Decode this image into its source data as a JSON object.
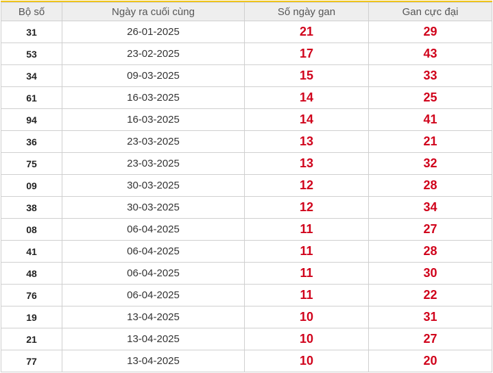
{
  "header": {
    "col_number": "Bộ số",
    "col_last_date": "Ngày ra cuối cùng",
    "col_days_gan": "Số ngày gan",
    "col_max_gan": "Gan cực đại"
  },
  "colors": {
    "accent_border": "#f0c419",
    "value_red": "#d0021b",
    "header_bg": "#eeeeee"
  },
  "rows": [
    {
      "number": "31",
      "last_date": "26-01-2025",
      "days_gan": "21",
      "max_gan": "29"
    },
    {
      "number": "53",
      "last_date": "23-02-2025",
      "days_gan": "17",
      "max_gan": "43"
    },
    {
      "number": "34",
      "last_date": "09-03-2025",
      "days_gan": "15",
      "max_gan": "33"
    },
    {
      "number": "61",
      "last_date": "16-03-2025",
      "days_gan": "14",
      "max_gan": "25"
    },
    {
      "number": "94",
      "last_date": "16-03-2025",
      "days_gan": "14",
      "max_gan": "41"
    },
    {
      "number": "36",
      "last_date": "23-03-2025",
      "days_gan": "13",
      "max_gan": "21"
    },
    {
      "number": "75",
      "last_date": "23-03-2025",
      "days_gan": "13",
      "max_gan": "32"
    },
    {
      "number": "09",
      "last_date": "30-03-2025",
      "days_gan": "12",
      "max_gan": "28"
    },
    {
      "number": "38",
      "last_date": "30-03-2025",
      "days_gan": "12",
      "max_gan": "34"
    },
    {
      "number": "08",
      "last_date": "06-04-2025",
      "days_gan": "11",
      "max_gan": "27"
    },
    {
      "number": "41",
      "last_date": "06-04-2025",
      "days_gan": "11",
      "max_gan": "28"
    },
    {
      "number": "48",
      "last_date": "06-04-2025",
      "days_gan": "11",
      "max_gan": "30"
    },
    {
      "number": "76",
      "last_date": "06-04-2025",
      "days_gan": "11",
      "max_gan": "22"
    },
    {
      "number": "19",
      "last_date": "13-04-2025",
      "days_gan": "10",
      "max_gan": "31"
    },
    {
      "number": "21",
      "last_date": "13-04-2025",
      "days_gan": "10",
      "max_gan": "27"
    },
    {
      "number": "77",
      "last_date": "13-04-2025",
      "days_gan": "10",
      "max_gan": "20"
    }
  ]
}
